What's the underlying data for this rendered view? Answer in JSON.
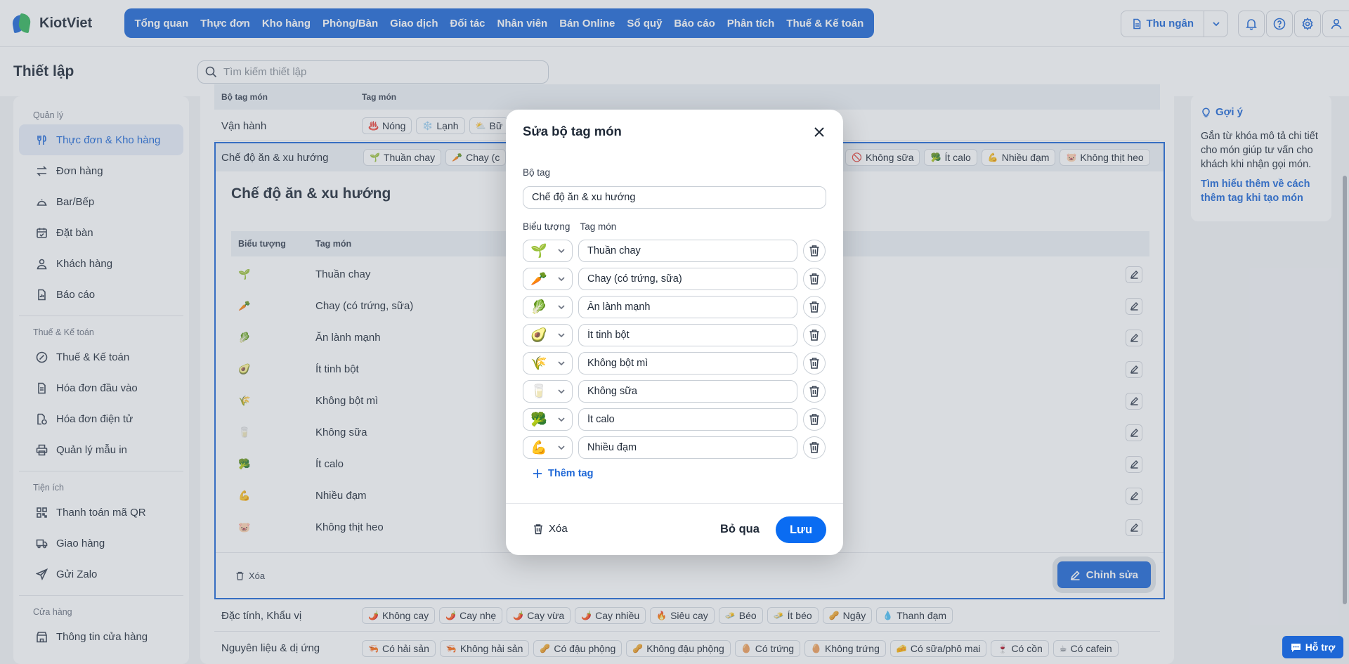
{
  "app": {
    "brand": "KiotViet"
  },
  "nav": [
    "Tổng quan",
    "Thực đơn",
    "Kho hàng",
    "Phòng/Bàn",
    "Giao dịch",
    "Đối tác",
    "Nhân viên",
    "Bán Online",
    "Sổ quỹ",
    "Báo cáo",
    "Phân tích",
    "Thuế & Kế toán"
  ],
  "header": {
    "cashier_label": "Thu ngân"
  },
  "page": {
    "title": "Thiết lập",
    "search_placeholder": "Tìm kiếm thiết lập"
  },
  "sidebar": {
    "groups": [
      {
        "title": "Quản lý",
        "items": [
          {
            "label": "Thực đơn & Kho hàng",
            "icon": "menu-icon",
            "active": true
          },
          {
            "label": "Đơn hàng",
            "icon": "swap-icon"
          },
          {
            "label": "Bar/Bếp",
            "icon": "dish-icon"
          },
          {
            "label": "Đặt bàn",
            "icon": "calendar-icon"
          },
          {
            "label": "Khách hàng",
            "icon": "user-icon"
          },
          {
            "label": "Báo cáo",
            "icon": "report-icon"
          }
        ]
      },
      {
        "title": "Thuế & Kế toán",
        "items": [
          {
            "label": "Thuế & Kế toán",
            "icon": "tax-icon"
          },
          {
            "label": "Hóa đơn đầu vào",
            "icon": "invoice-icon"
          },
          {
            "label": "Hóa đơn điện tử",
            "icon": "einvoice-icon"
          },
          {
            "label": "Quản lý mẫu in",
            "icon": "printer-icon"
          }
        ]
      },
      {
        "title": "Tiện ích",
        "items": [
          {
            "label": "Thanh toán mã QR",
            "icon": "qr-icon"
          },
          {
            "label": "Giao hàng",
            "icon": "truck-icon"
          },
          {
            "label": "Gửi Zalo",
            "icon": "send-icon"
          }
        ]
      },
      {
        "title": "Cửa hàng",
        "items": [
          {
            "label": "Thông tin cửa hàng",
            "icon": "store-icon"
          }
        ]
      }
    ]
  },
  "table": {
    "col_set": "Bộ tag món",
    "col_tags": "Tag món",
    "rows": [
      {
        "label": "Vận hành",
        "tags": [
          {
            "icon": "♨️",
            "label": "Nóng"
          },
          {
            "icon": "❄️",
            "label": "Lạnh"
          },
          {
            "icon": "⛅",
            "label": "Bữ"
          }
        ]
      },
      {
        "label": "Chế độ ăn & xu hướng",
        "tags_left": [
          {
            "icon": "🌱",
            "label": "Thuần chay"
          },
          {
            "icon": "🥕",
            "label": "Chay (c"
          }
        ],
        "tags_right": [
          {
            "icon": "🚫",
            "label": "Không sữa"
          },
          {
            "icon": "🥦",
            "label": "Ít calo"
          },
          {
            "icon": "💪",
            "label": "Nhiều đạm"
          },
          {
            "icon": "🐷",
            "label": "Không thịt heo"
          }
        ]
      },
      {
        "label": "Đặc tính, Khẩu vị",
        "tags": [
          {
            "icon": "🌶️",
            "label": "Không cay"
          },
          {
            "icon": "🌶️",
            "label": "Cay nhẹ"
          },
          {
            "icon": "🌶️",
            "label": "Cay vừa"
          },
          {
            "icon": "🌶️",
            "label": "Cay nhiều"
          },
          {
            "icon": "🔥",
            "label": "Siêu cay"
          },
          {
            "icon": "🧈",
            "label": "Béo"
          },
          {
            "icon": "🧈",
            "label": "Ít béo"
          },
          {
            "icon": "🥜",
            "label": "Ngậy"
          },
          {
            "icon": "💧",
            "label": "Thanh đạm"
          }
        ]
      },
      {
        "label": "Nguyên liệu & dị ứng",
        "tags": [
          {
            "icon": "🦐",
            "label": "Có hải sản"
          },
          {
            "icon": "🦐",
            "label": "Không hải sản"
          },
          {
            "icon": "🥜",
            "label": "Có đậu phộng"
          },
          {
            "icon": "🥜",
            "label": "Không đậu phộng"
          },
          {
            "icon": "🥚",
            "label": "Có trứng"
          },
          {
            "icon": "🥚",
            "label": "Không trứng"
          },
          {
            "icon": "🧀",
            "label": "Có sữa/phô mai"
          },
          {
            "icon": "🍷",
            "label": "Có cồn"
          },
          {
            "icon": "☕",
            "label": "Có cafein"
          }
        ]
      }
    ]
  },
  "expanded": {
    "title": "Chế độ ăn & xu hướng",
    "col_icon": "Biểu tượng",
    "col_tag": "Tag món",
    "items": [
      {
        "icon": "🌱",
        "label": "Thuần chay"
      },
      {
        "icon": "🥕",
        "label": "Chay (có trứng, sữa)"
      },
      {
        "icon": "🥬",
        "label": "Ăn lành mạnh"
      },
      {
        "icon": "🥑",
        "label": "Ít tinh bột"
      },
      {
        "icon": "🌾",
        "label": "Không bột mì"
      },
      {
        "icon": "🥛",
        "label": "Không sữa"
      },
      {
        "icon": "🥦",
        "label": "Ít calo"
      },
      {
        "icon": "💪",
        "label": "Nhiều đạm"
      },
      {
        "icon": "🐷",
        "label": "Không thịt heo"
      }
    ],
    "delete_label": "Xóa",
    "edit_label": "Chỉnh sửa"
  },
  "hint": {
    "title": "Gợi ý",
    "text": "Gắn từ khóa mô tả chi tiết cho món giúp tư vấn cho khách khi nhận gọi món.",
    "link": "Tìm hiểu thêm về cách thêm tag khi tạo món"
  },
  "support": {
    "label": "Hỗ trợ"
  },
  "modal": {
    "title": "Sửa bộ tag món",
    "set_label": "Bộ tag",
    "set_value": "Chế độ ăn & xu hướng",
    "col_icon": "Biểu tượng",
    "col_tag": "Tag món",
    "tags": [
      {
        "icon": "🌱",
        "value": "Thuần chay"
      },
      {
        "icon": "🥕",
        "value": "Chay (có trứng, sữa)"
      },
      {
        "icon": "🥬",
        "value": "Ăn lành mạnh"
      },
      {
        "icon": "🥑",
        "value": "Ít tinh bột"
      },
      {
        "icon": "🌾",
        "value": "Không bột mì"
      },
      {
        "icon": "🥛",
        "value": "Không sữa"
      },
      {
        "icon": "🥦",
        "value": "Ít calo"
      },
      {
        "icon": "💪",
        "value": "Nhiều đạm"
      }
    ],
    "add_label": "Thêm tag",
    "delete_label": "Xóa",
    "cancel_label": "Bỏ qua",
    "save_label": "Lưu"
  },
  "colors": {
    "accent": "#1e67d6",
    "save": "#0a6cf2"
  }
}
